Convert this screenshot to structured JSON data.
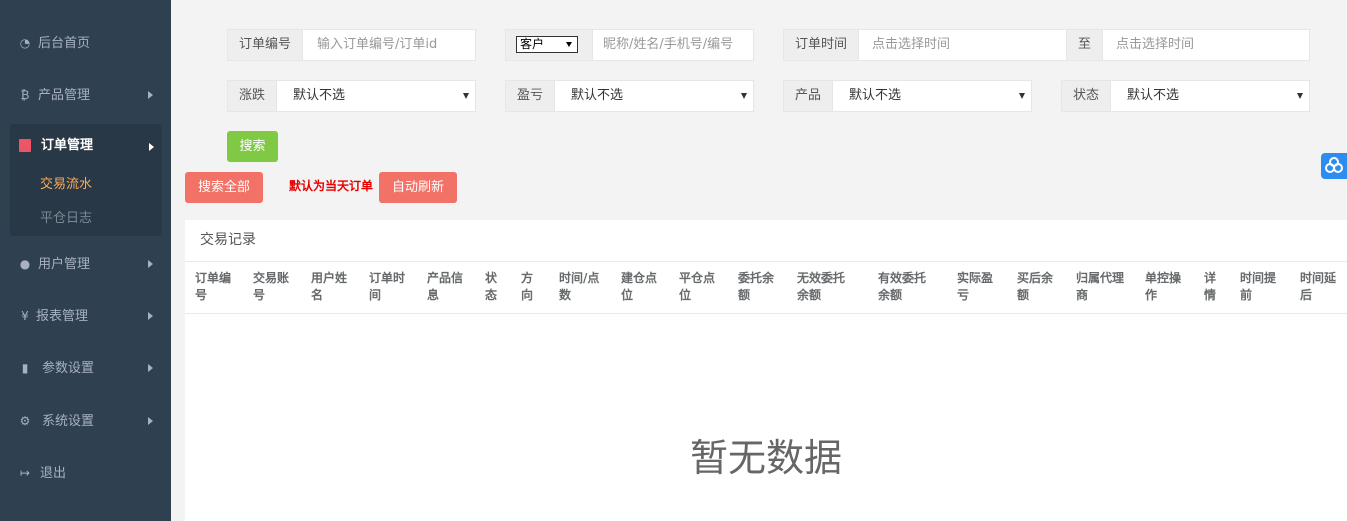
{
  "sidebar": {
    "items": [
      {
        "label": "后台首页",
        "icon": "dashboard-icon"
      },
      {
        "label": "产品管理",
        "icon": "bitcoin-icon"
      },
      {
        "label": "订单管理",
        "icon": "orders-icon"
      },
      {
        "label": "用户管理",
        "icon": "user-icon"
      },
      {
        "label": "报表管理",
        "icon": "yen-icon"
      },
      {
        "label": "参数设置",
        "icon": "copy-icon"
      },
      {
        "label": "系统设置",
        "icon": "gears-icon"
      },
      {
        "label": "退出",
        "icon": "signout-icon"
      }
    ],
    "sub": [
      "交易流水",
      "平仓日志"
    ],
    "yen_glyph": "¥",
    "bitcoin_glyph": "₿"
  },
  "filters": {
    "order_no": {
      "label": "订单编号",
      "placeholder": "输入订单编号/订单id"
    },
    "customer": {
      "select": "客户",
      "placeholder": "昵称/姓名/手机号/编号"
    },
    "order_time": {
      "label": "订单时间",
      "placeholder_from": "点击选择时间",
      "to": "至",
      "placeholder_to": "点击选择时间"
    },
    "rise_fall": {
      "label": "涨跌",
      "value": "默认不选"
    },
    "profit": {
      "label": "盈亏",
      "value": "默认不选"
    },
    "product": {
      "label": "产品",
      "value": "默认不选"
    },
    "status": {
      "label": "状态",
      "value": "默认不选"
    }
  },
  "actions": {
    "search": "搜索",
    "search_all": "搜索全部",
    "hint": "默认为当天订单",
    "auto_refresh": "自动刷新"
  },
  "panel": {
    "title": "交易记录",
    "empty": "暂无数据",
    "columns": [
      [
        "订单编",
        "号"
      ],
      [
        "交易账",
        "号"
      ],
      [
        "用户姓",
        "名"
      ],
      [
        "订单时",
        "间"
      ],
      [
        "产品信",
        "息"
      ],
      [
        "状",
        "态"
      ],
      [
        "方",
        "向"
      ],
      [
        "时间/点",
        "数"
      ],
      [
        "建仓点",
        "位"
      ],
      [
        "平仓点",
        "位"
      ],
      [
        "委托余",
        "额"
      ],
      [
        "无效委托",
        "余额"
      ],
      [
        "有效委托",
        "余额"
      ],
      [
        "实际盈",
        "亏"
      ],
      [
        "买后余",
        "额"
      ],
      [
        "归属代理",
        "商"
      ],
      [
        "单控操",
        "作"
      ],
      [
        "详",
        "情"
      ],
      [
        "时间提",
        "前"
      ],
      [
        "时间延",
        "后"
      ]
    ]
  },
  "colors": {
    "sidebar": "#2f4050",
    "accent_active": "#f8ac59",
    "green": "#7fc944",
    "red": "#f27268"
  }
}
